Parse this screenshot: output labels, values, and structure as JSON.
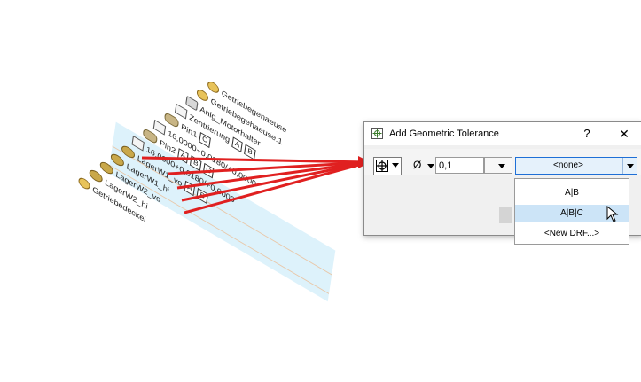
{
  "tree": {
    "rows": [
      {
        "label": "Getriebegehaeuse",
        "icon": "part-icon",
        "boxes": []
      },
      {
        "label": "Getriebegehaeuse.1",
        "icon": "part-icon",
        "boxes": []
      },
      {
        "label": "Anlg_Motorhalter",
        "icon": "gear-icon",
        "boxes": []
      },
      {
        "label": "Zentrierung",
        "icon": "datum-icon",
        "boxes": [
          "A",
          "B"
        ]
      },
      {
        "label": "Pin1",
        "icon": "pin-icon",
        "boxes": [
          "C"
        ]
      },
      {
        "label": "16,0000+0,0180/+0,0000",
        "icon": "dim-icon",
        "boxes": []
      },
      {
        "label": "Pin2",
        "icon": "pin-icon",
        "boxes": [
          "A",
          "B",
          "C"
        ]
      },
      {
        "label": "16,0000+0,0180/+0,0000",
        "icon": "dim-icon",
        "boxes": []
      },
      {
        "label": "LagerW1_vo",
        "icon": "bearing-icon",
        "boxes": [
          "A",
          "B"
        ]
      },
      {
        "label": "LagerW1_hi",
        "icon": "bearing-icon",
        "boxes": []
      },
      {
        "label": "LagerW2_vo",
        "icon": "bearing-icon",
        "boxes": []
      },
      {
        "label": "LagerW2_hi",
        "icon": "bearing-icon",
        "boxes": []
      },
      {
        "label": "Getriebedeckel",
        "icon": "part-icon",
        "boxes": []
      }
    ]
  },
  "dialog": {
    "title": "Add Geometric Tolerance",
    "help_label": "?",
    "close_label": "✕",
    "diameter_symbol": "Ø",
    "tolerance_value": "0,1",
    "drf_value": "<none>",
    "dropdown_options": [
      "A|B",
      "A|B|C",
      "<New DRF...>"
    ],
    "dropdown_selected": 1
  },
  "colors": {
    "pointer": "#e02020",
    "selection": "#cce4f7",
    "accent_border": "#1f6fd6"
  }
}
